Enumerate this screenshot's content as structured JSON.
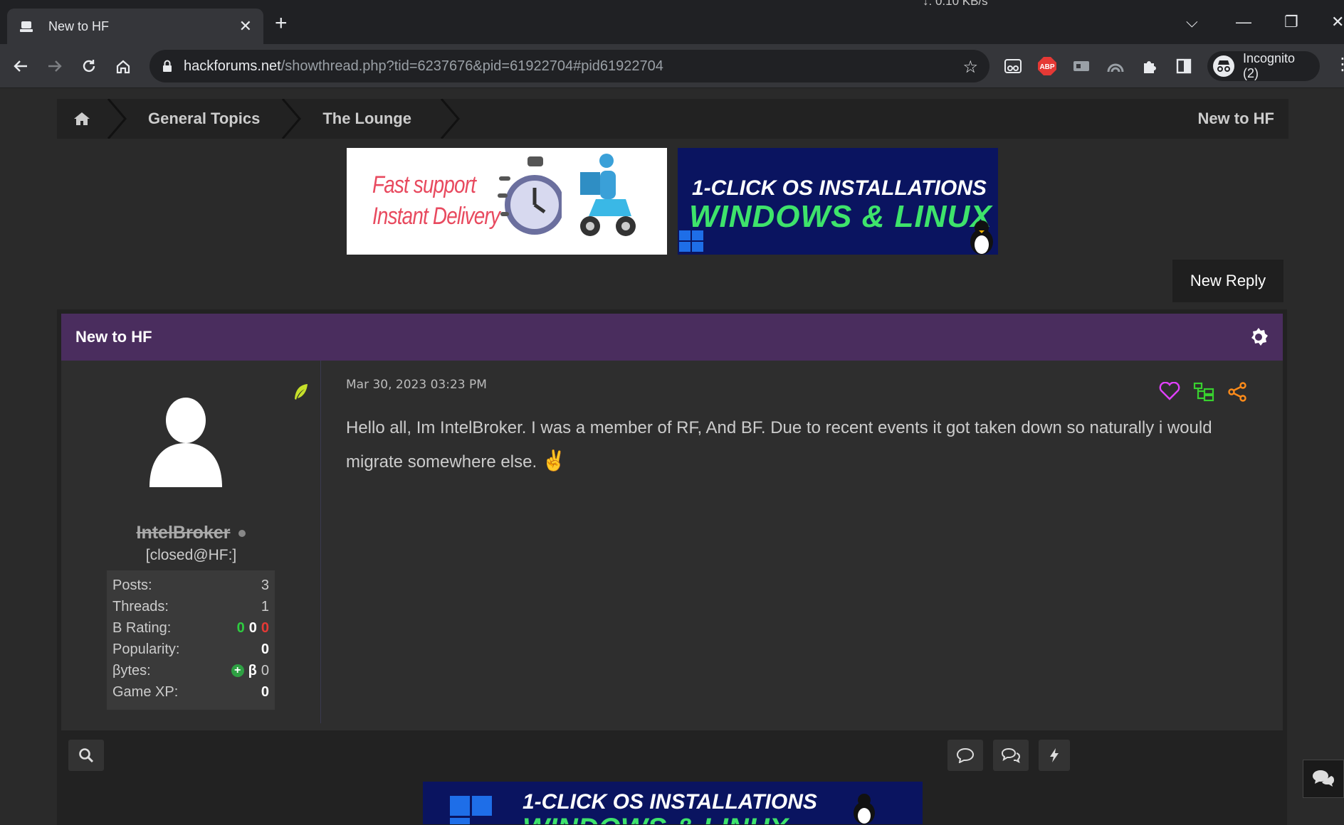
{
  "browser": {
    "tab_title": "New to HF",
    "speed_indicator": "↓: 0.10 KB/s",
    "url_host": "hackforums.net",
    "url_path": "/showthread.php?tid=6237676&pid=61922704#pid61922704",
    "profile_label": "Incognito (2)",
    "extension_abp": "ABP"
  },
  "breadcrumb": {
    "items": [
      "General Topics",
      "The Lounge"
    ],
    "current": "New to HF"
  },
  "ads": {
    "ad1_line1": "Fast support",
    "ad1_line2": "Instant Delivery",
    "ad2_line1": "1-CLICK OS INSTALLATIONS",
    "ad2_line2": "WINDOWS & LINUX",
    "bottom_line1": "1-CLICK OS INSTALLATIONS",
    "bottom_line2": "WINDOWS & LINUX"
  },
  "new_reply_label": "New Reply",
  "thread": {
    "title": "New to HF"
  },
  "post": {
    "date": "Mar 30, 2023 03:23 PM",
    "body": "Hello all, Im IntelBroker. I was a member of RF, And BF. Due to recent events it got taken down so naturally i would migrate somewhere else.",
    "emoji": "✌️",
    "user": {
      "name": "IntelBroker",
      "title": "[closed@HF:]",
      "stats": {
        "posts_label": "Posts:",
        "posts": "3",
        "threads_label": "Threads:",
        "threads": "1",
        "brating_label": "B Rating:",
        "brating_pos": "0",
        "brating_neu": "0",
        "brating_neg": "0",
        "popularity_label": "Popularity:",
        "popularity": "0",
        "bytes_label": "βytes:",
        "bytes_symbol": "β",
        "bytes": "0",
        "gamexp_label": "Game XP:",
        "gamexp": "0"
      }
    }
  },
  "colors": {
    "thread_header": "#4a2d5e",
    "like": "#e040fb",
    "tree": "#39d12f",
    "share": "#ff8c1a"
  }
}
